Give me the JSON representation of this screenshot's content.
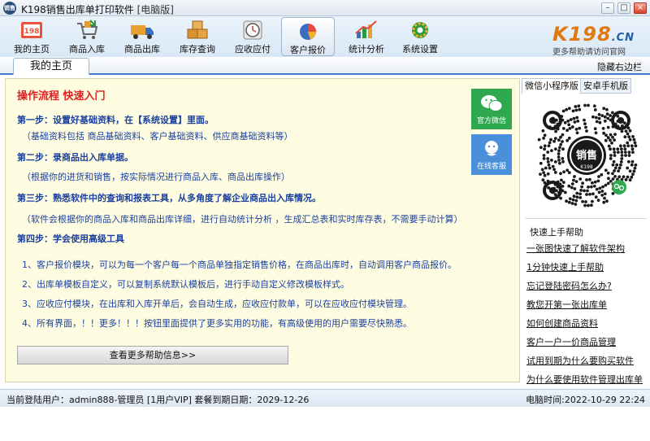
{
  "window": {
    "logo_text": "销售",
    "title": "K198销售出库单打印软件",
    "edition": "[电脑版]",
    "min": "–",
    "max": "□",
    "close": "×"
  },
  "toolbar": {
    "items": [
      {
        "label": "我的主页",
        "icon": "home-icon"
      },
      {
        "label": "商品入库",
        "icon": "cart-icon"
      },
      {
        "label": "商品出库",
        "icon": "truck-icon"
      },
      {
        "label": "库存查询",
        "icon": "boxes-icon"
      },
      {
        "label": "应收应付",
        "icon": "clock-icon"
      },
      {
        "label": "客户报价",
        "icon": "pie-chart-icon"
      },
      {
        "label": "统计分析",
        "icon": "bar-chart-icon"
      },
      {
        "label": "系统设置",
        "icon": "gear-icon"
      }
    ],
    "active_index": 5
  },
  "brand": {
    "logo": "K198",
    "logo_suffix": ".CN",
    "sub": "更多帮助请访问官网"
  },
  "tabs": {
    "home": "我的主页",
    "hide_sidebar": "隐藏右边栏"
  },
  "guide": {
    "title": "操作流程  快速入门",
    "step1": "第一步：设置好基础资料，在【系统设置】里面。",
    "note1": "（基础资料包括 商品基础资料、客户基础资料、供应商基础资料等）",
    "step2": "第二步：录商品出入库单据。",
    "note2": "（根据你的进货和销售，按实际情况进行商品入库、商品出库操作）",
    "step3": "第三步：熟悉软件中的查询和报表工具，从多角度了解企业商品出入库情况。",
    "note3": "（软件会根据你的商品入库和商品出库详细，进行自动统计分析 ，生成汇总表和实时库存表，不需要手动计算）",
    "step4": "第四步：学会使用高级工具",
    "items": [
      "1、客户报价模块，可以为每一个客户每一个商品单独指定销售价格，在商品出库时，自动调用客户商品报价。",
      "2、出库单模板自定义，可以复制系统默认模板后，进行手动自定义修改模板样式。",
      "3、应收应付模块，在出库和入库开单后，会自动生成，应收应付款单，可以在应收应付模块管理。",
      "4、所有界面，！！更多！！！按钮里面提供了更多实用的功能，有高级使用的用户需要尽快熟悉。"
    ],
    "more_button": "查看更多帮助信息>>",
    "wechat_label": "官方微信",
    "service_label": "在线客服"
  },
  "sidebar": {
    "tab_miniprogram": "微信小程序版",
    "tab_android": "安卓手机版",
    "qr_label": "销售",
    "qr_sub": "K198",
    "help_title": "快速上手帮助",
    "links": [
      "一张图快速了解软件架构",
      "1分钟快速上手帮助",
      "忘记登陆密码怎么办?",
      "教您开第一张出库单",
      "如何创建商品资料",
      "客户一户一价商品管理",
      "试用到期为什么要购买软件",
      "为什么要使用软件管理出库单"
    ]
  },
  "status": {
    "left": "当前登陆用户：admin888-管理员  [1用户VIP]  套餐到期日期：2029-12-26",
    "right": "电脑时间:2022-10-29 22:24"
  },
  "colors": {
    "accent": "#3b7ed1",
    "guide_text": "#1a3fa0",
    "guide_title": "#e02020",
    "wechat": "#2fa84f",
    "service": "#4a8fd9"
  }
}
